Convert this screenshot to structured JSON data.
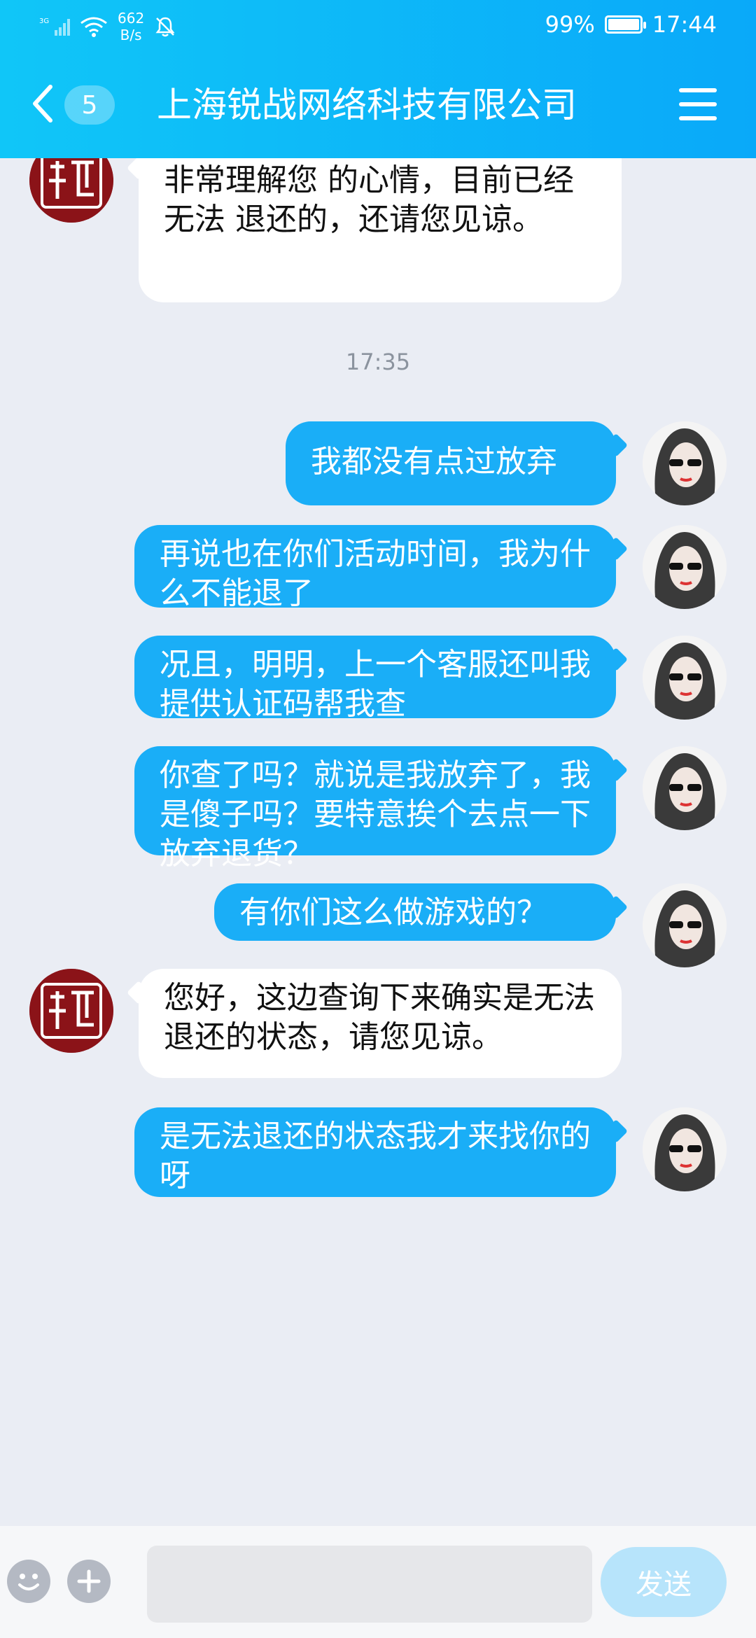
{
  "status_bar": {
    "network": "3G",
    "net_speed_value": "662",
    "net_speed_unit": "B/s",
    "battery": "99%",
    "battery_level": 0.99,
    "time": "17:44"
  },
  "header": {
    "back_badge": "5",
    "title": "上海锐战网络科技有限公司",
    "colors": {
      "gradient_start": "#10c6f8",
      "gradient_end": "#0aa9f9"
    }
  },
  "chat": {
    "messages": [
      {
        "sender": "company",
        "text": "非常理解您 的心情，目前已经无法 退还的，还请您见谅。"
      },
      {
        "type": "timestamp",
        "text": "17:35"
      },
      {
        "sender": "user",
        "text": "我都没有点过放弃"
      },
      {
        "sender": "user",
        "text": "再说也在你们活动时间，我为什么不能退了"
      },
      {
        "sender": "user",
        "text": "况且，明明，上一个客服还叫我提供认证码帮我查"
      },
      {
        "sender": "user",
        "text": "你查了吗？就说是我放弃了，我是傻子吗？要特意挨个去点一下放弃退货？"
      },
      {
        "sender": "user",
        "text": "有你们这么做游戏的？"
      },
      {
        "sender": "company",
        "text": "您好，这边查询下来确实是无法退还的状态，请您见谅。"
      },
      {
        "sender": "user",
        "text": "是无法退还的状态我才来找你的呀"
      }
    ],
    "colors": {
      "background": "#eaedf4",
      "outgoing_bubble": "#1aaef7",
      "incoming_bubble": "#ffffff"
    },
    "company_avatar_text": "虞世堂"
  },
  "input_bar": {
    "text_value": "",
    "send_label": "发送",
    "icons": [
      "emoji-icon",
      "plus-icon"
    ]
  }
}
